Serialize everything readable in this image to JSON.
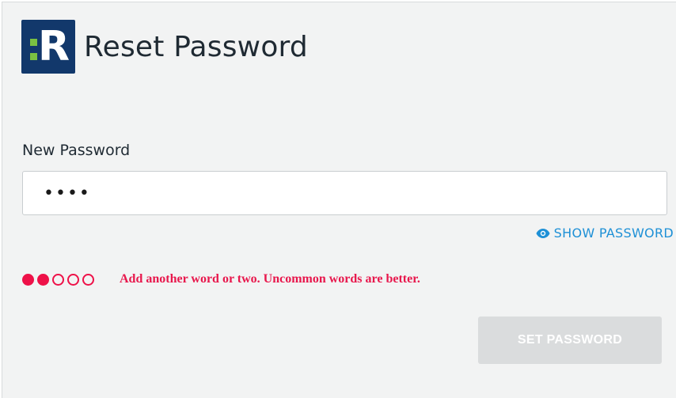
{
  "header": {
    "logo_letter": "R",
    "title": "Reset Password"
  },
  "form": {
    "new_password_label": "New Password",
    "password_value": "••••",
    "show_password_label": "SHOW PASSWORD",
    "strength": {
      "level": 2,
      "max": 5,
      "message": "Add another word or two. Uncommon words are better."
    },
    "submit_label": "SET PASSWORD"
  },
  "colors": {
    "brand_navy": "#12386b",
    "brand_green": "#7ac142",
    "accent_link": "#1e90d6",
    "warning_red": "#ee1148",
    "disabled_button": "#dadcdd"
  },
  "icons": {
    "show_password": "eye-icon"
  }
}
